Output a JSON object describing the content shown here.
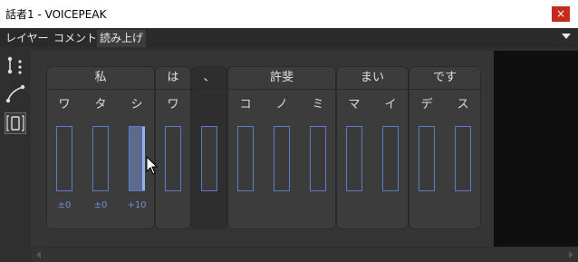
{
  "window": {
    "title": "話者1 - VOICEPEAK",
    "close_glyph": "×"
  },
  "tabs": [
    "レイヤー",
    "コメント",
    "読み上げ"
  ],
  "active_tab": "読み上げ",
  "tools": [
    {
      "name": "node-tool-icon"
    },
    {
      "name": "curve-tool-icon"
    },
    {
      "name": "range-tool-icon",
      "selected": true
    }
  ],
  "groups": [
    {
      "label": "私",
      "morae": [
        "ワ",
        "タ",
        "シ"
      ],
      "values": [
        "±0",
        "±0",
        "+10"
      ]
    },
    {
      "label": "は",
      "morae": [
        "ワ"
      ],
      "values": [
        ""
      ]
    },
    {
      "label": "、",
      "morae": [
        ""
      ],
      "values": [
        ""
      ]
    },
    {
      "label": "許斐",
      "morae": [
        "コ",
        "ノ",
        "ミ"
      ],
      "values": [
        "",
        "",
        ""
      ]
    },
    {
      "label": "まい",
      "morae": [
        "マ",
        "イ"
      ],
      "values": [
        "",
        ""
      ]
    },
    {
      "label": "です",
      "morae": [
        "デ",
        "ス"
      ],
      "values": [
        "",
        ""
      ]
    }
  ],
  "colors": {
    "slider_border": "#5b7bc6",
    "value_text": "#6f8fd8",
    "close": "#c42b1c"
  }
}
